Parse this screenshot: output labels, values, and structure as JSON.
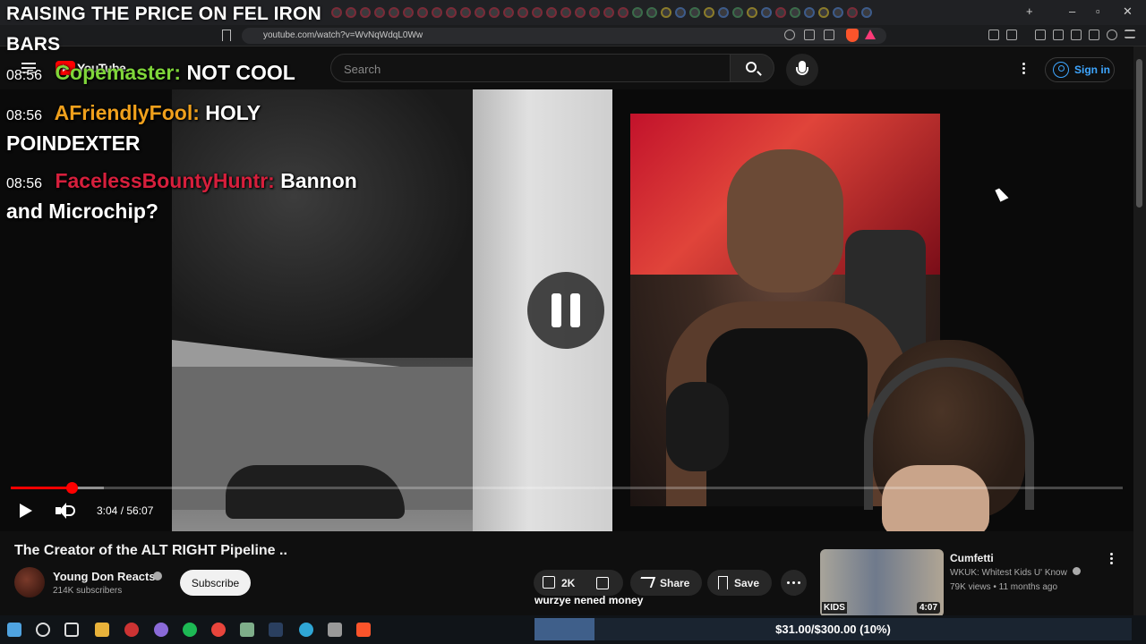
{
  "browser": {
    "url": "youtube.com/watch?v=WvNqWdqL0Ww"
  },
  "youtube": {
    "logo_text": "YouTube",
    "search_placeholder": "Search",
    "signin_label": "Sign in"
  },
  "overlay": {
    "title_line1": "RAISING THE PRICE ON FEL IRON",
    "title_line2": "BARS"
  },
  "chat": [
    {
      "time": "08:56",
      "user": "Copemaster:",
      "message": "NOT COOL",
      "color": "#7fd63a"
    },
    {
      "time": "08:56",
      "user": "AFriendlyFool:",
      "message": "HOLY",
      "message_cont": "POINDEXTER",
      "color": "#f0a01c"
    },
    {
      "time": "08:56",
      "user": "FacelessBountyHuntr:",
      "message": "Bannon",
      "message_cont": "and Microchip?",
      "color": "#d61f3c"
    }
  ],
  "player": {
    "time_current": "3:04",
    "time_separator": " / ",
    "time_total": "56:07",
    "progress_fraction": 0.0546,
    "buffered_fraction": 0.084
  },
  "video": {
    "title": "The Creator of the ALT RIGHT Pipeline ..",
    "channel_name": "Young Don Reacts",
    "subscribers": "214K subscribers",
    "subscribe_label": "Subscribe",
    "likes": "2K",
    "share_label": "Share",
    "save_label": "Save"
  },
  "donation": {
    "message": "wurzye nened money",
    "goal_text": "$31.00/$300.00 (10%)",
    "goal_fraction": 0.1
  },
  "recommended": {
    "title": "Cumfetti",
    "channel": "WKUK: Whitest Kids U' Know",
    "views": "79K views",
    "age": "11 months ago",
    "duration": "4:07",
    "thumb_text": "KIDS"
  }
}
